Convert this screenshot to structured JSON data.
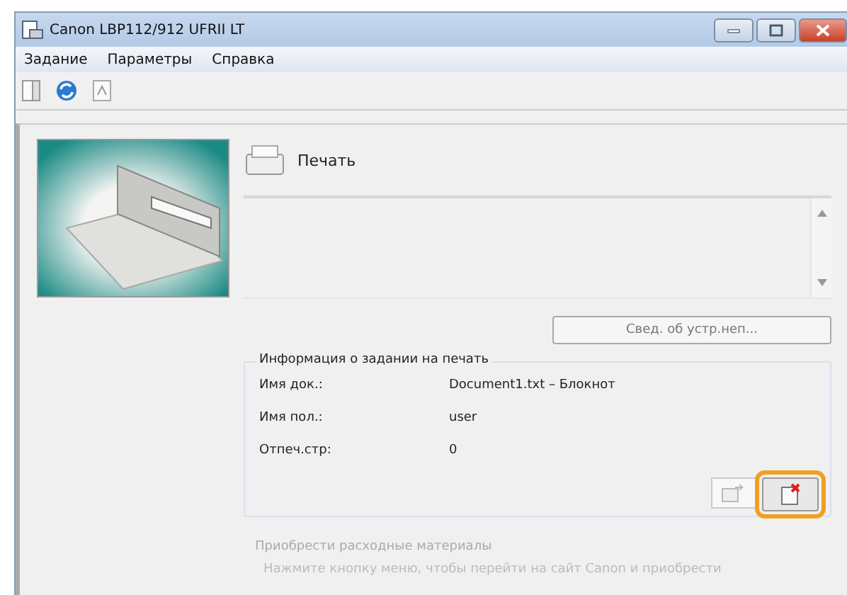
{
  "window": {
    "title": "Canon LBP112/912 UFRII LT"
  },
  "menu": [
    "Задание",
    "Параметры",
    "Справка"
  ],
  "status": {
    "title": "Печать"
  },
  "device_button": "Свед. об устр.неп...",
  "job_info": {
    "legend": "Информация о задании на печать",
    "rows": [
      {
        "label": "Имя док.:",
        "value": "Document1.txt – Блокнот"
      },
      {
        "label": "Имя пол.:",
        "value": "user"
      },
      {
        "label": "Отпеч.стр:",
        "value": "0"
      }
    ],
    "buttons": [
      {
        "kind": "move",
        "highlighted": false
      },
      {
        "kind": "cancel",
        "highlighted": true
      }
    ]
  },
  "consumables": {
    "title": "Приобрести расходные материалы",
    "text": "Нажмите кнопку меню, чтобы перейти на сайт Canon и приобрести"
  }
}
